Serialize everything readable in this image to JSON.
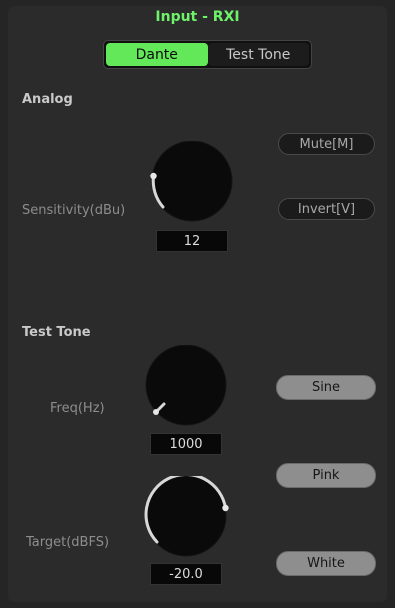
{
  "header": {
    "title": "Input - RXI"
  },
  "source_tabs": [
    {
      "label": "Dante",
      "active": true
    },
    {
      "label": "Test Tone",
      "active": false
    }
  ],
  "analog": {
    "section_label": "Analog",
    "sensitivity_label": "Sensitivity(dBu)",
    "sensitivity_value": "12",
    "mute_label": "Mute[M]",
    "invert_label": "Invert[V]"
  },
  "test_tone": {
    "section_label": "Test Tone",
    "freq_label": "Freq(Hz)",
    "freq_value": "1000",
    "target_label": "Target(dBFS)",
    "target_value": "-20.0",
    "waveforms": [
      "Sine",
      "Pink",
      "White"
    ]
  },
  "colors": {
    "accent_green": "#63e85a",
    "title_green": "#6ef26a",
    "knob_indicator": "#e8e8e8"
  }
}
